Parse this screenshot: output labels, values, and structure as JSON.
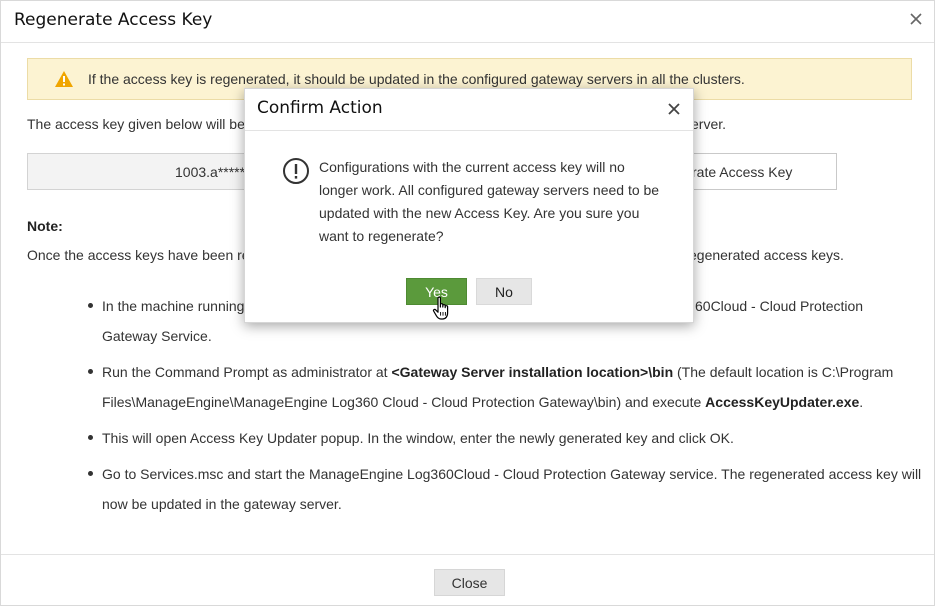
{
  "dialog": {
    "title": "Regenerate Access Key",
    "close_icon": "close-icon",
    "warning": {
      "icon": "warning-icon",
      "text": "If the access key is regenerated, it should be updated in the configured gateway servers in all the clusters."
    },
    "description_visible": "The access key given below will be",
    "description_tail": "erver.",
    "access_key_value": "1003.a*****",
    "regenerate_button_label": "rate Access Key",
    "note": {
      "title": "Note:",
      "text_visible": "Once the access keys have been re",
      "text_tail": "egenerated access keys.",
      "bullets": [
        {
          "line1_visible": "In the machine running",
          "line1_tail": "60Cloud - Cloud Protection",
          "line2": "Gateway Service."
        },
        {
          "line1_a": "Run the Command Prompt as administrator at ",
          "line1_b": "<Gateway Server installation location>\\bin",
          "line1_c": " (The default location is C:\\Program",
          "line2_a": "Files\\ManageEngine\\ManageEngine Log360 Cloud - Cloud Protection Gateway\\bin) and execute ",
          "line2_b": "AccessKeyUpdater.exe",
          "line2_c": "."
        },
        {
          "line1": "This will open Access Key Updater popup. In the window, enter the newly generated key and click OK."
        },
        {
          "line1": "Go to Services.msc and start the ManageEngine Log360Cloud - Cloud Protection Gateway service. The regenerated access key will",
          "line2": "now be updated in the gateway server."
        }
      ]
    },
    "close_button_label": "Close"
  },
  "confirm_modal": {
    "title": "Confirm Action",
    "close_icon": "close-icon",
    "alert_icon": "exclamation-circle-icon",
    "message_lines": [
      "Configurations with the current access key will no",
      "longer work. All configured gateway servers need to be",
      "updated with the new Access Key. Are you sure you",
      "want to regenerate?"
    ],
    "yes_label": "Yes",
    "no_label": "No"
  },
  "colors": {
    "yes_button": "#5b9a3c",
    "warning_banner": "#fcf3d2",
    "warning_icon": "#f0a500"
  },
  "cursor_icon": "hand-pointer-icon"
}
